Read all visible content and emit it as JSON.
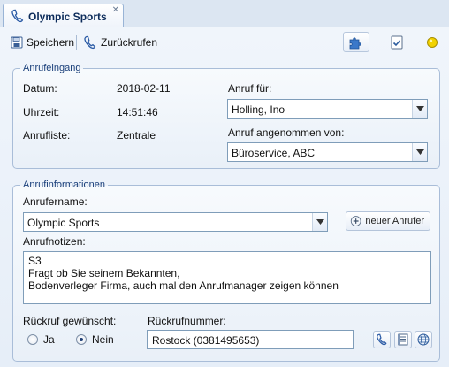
{
  "tab": {
    "title": "Olympic Sports",
    "close": "✕"
  },
  "toolbar": {
    "save_label": "Speichern",
    "callback_label": "Zurückrufen"
  },
  "incoming": {
    "legend": "Anrufeingang",
    "date_label": "Datum:",
    "date_value": "2018-02-11",
    "time_label": "Uhrzeit:",
    "time_value": "14:51:46",
    "list_label": "Anrufliste:",
    "list_value": "Zentrale",
    "call_for_label": "Anruf für:",
    "call_for_value": "Holling, Ino",
    "accepted_by_label": "Anruf angenommen von:",
    "accepted_by_value": "Büroservice, ABC"
  },
  "info": {
    "legend": "Anrufinformationen",
    "caller_name_label": "Anrufername:",
    "caller_name_value": "Olympic Sports",
    "new_caller_label": "neuer Anrufer",
    "notes_label": "Anrufnotizen:",
    "notes_lines": [
      "S3",
      "Fragt ob Sie seinem Bekannten,",
      "Bodenverleger Firma, auch mal den Anrufmanager zeigen können"
    ],
    "callback_wanted_label": "Rückruf gewünscht:",
    "yes_label": "Ja",
    "no_label": "Nein",
    "callback_selected": "Nein",
    "callback_number_label": "Rückrufnummer:",
    "callback_number_value": "Rostock (0381495653)"
  },
  "colors": {
    "accent": "#1a3f7a",
    "status_light": "#f2d200"
  },
  "icons": [
    "phone-icon",
    "save-icon",
    "puzzle-icon",
    "checklist-icon",
    "status-light-icon",
    "add-icon",
    "address-book-icon",
    "globe-icon",
    "dropdown-arrow-icon"
  ]
}
